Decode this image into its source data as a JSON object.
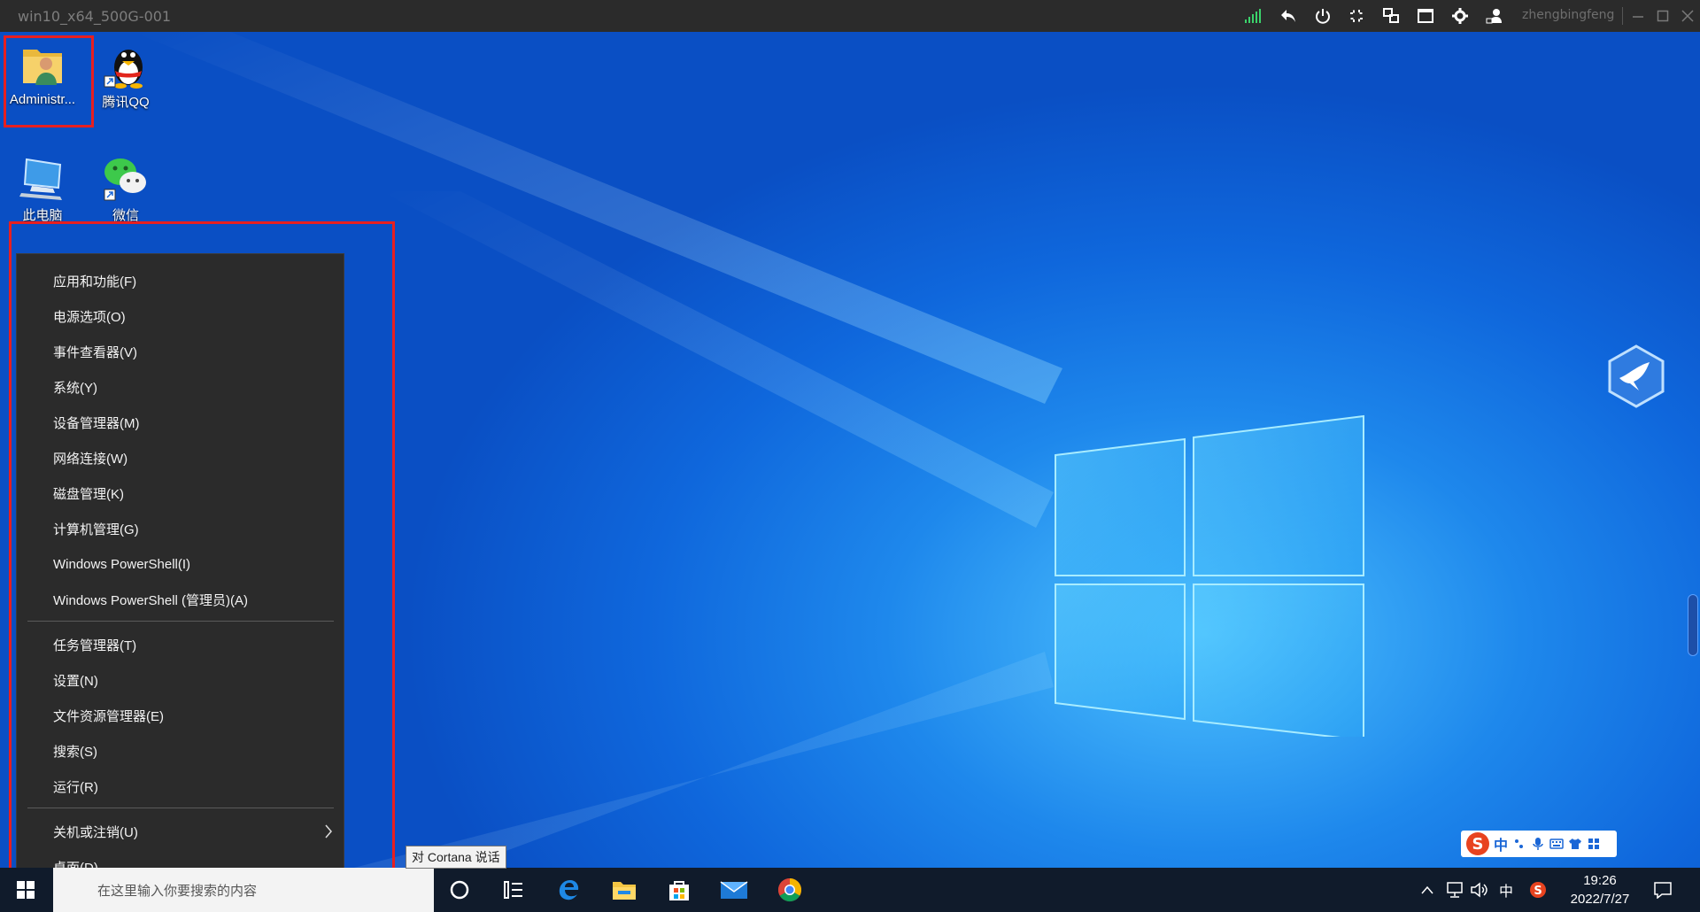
{
  "rdp": {
    "title": "win10_x64_500G-001",
    "user": "zhengbingfeng",
    "tools": [
      "signal-icon",
      "undo-icon",
      "power-icon",
      "fullscreen-exit-icon",
      "switch-screen-icon",
      "window-icon",
      "settings-icon",
      "user-share-icon"
    ]
  },
  "desktop": {
    "icons": [
      {
        "label": "Administr...",
        "icon": "user-folder-icon"
      },
      {
        "label": "腾讯QQ",
        "icon": "qq-penguin-icon"
      },
      {
        "label": "此电脑",
        "icon": "this-pc-icon"
      },
      {
        "label": "微信",
        "icon": "wechat-icon"
      }
    ]
  },
  "menu": {
    "group1": [
      "应用和功能(F)",
      "电源选项(O)",
      "事件查看器(V)",
      "系统(Y)",
      "设备管理器(M)",
      "网络连接(W)",
      "磁盘管理(K)",
      "计算机管理(G)",
      "Windows PowerShell(I)",
      "Windows PowerShell (管理员)(A)"
    ],
    "group2": [
      "任务管理器(T)",
      "设置(N)",
      "文件资源管理器(E)",
      "搜索(S)",
      "运行(R)"
    ],
    "group3": [
      "关机或注销(U)",
      "桌面(D)"
    ]
  },
  "taskbar": {
    "search_placeholder": "在这里输入你要搜索的内容",
    "cortana_tip": "对 Cortana 说话",
    "ime_lang": "中",
    "time": "19:26",
    "date": "2022/7/27"
  },
  "ime": {
    "logo": "S",
    "lang": "中"
  },
  "colors": {
    "accent": "#0a5fd8",
    "menu_bg": "#2b2b2b",
    "highlight": "#e81f1f",
    "taskbar": "#101b2b"
  }
}
